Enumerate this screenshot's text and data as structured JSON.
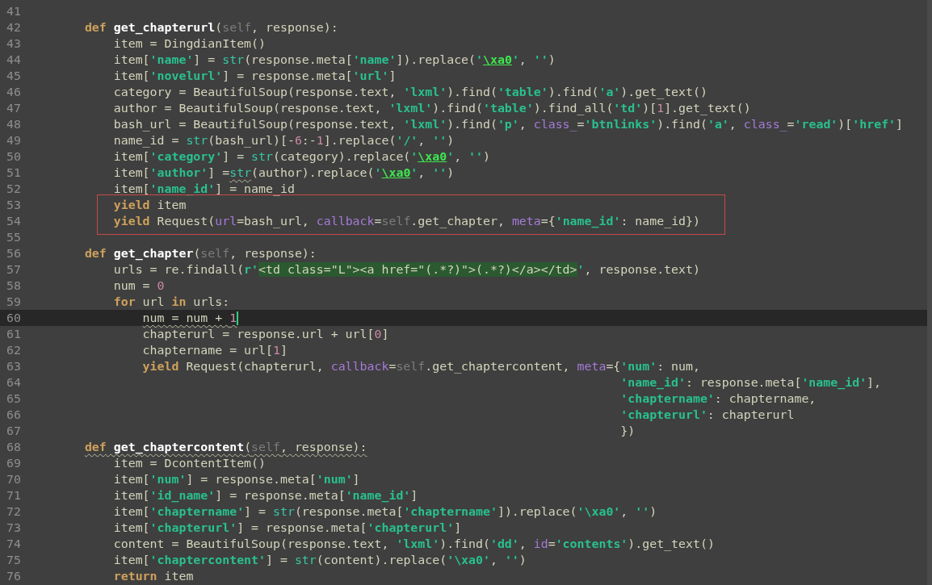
{
  "editor": {
    "lines": [
      {
        "number": "41",
        "current": false
      },
      {
        "number": "42",
        "current": false,
        "segments": [
          {
            "text": "    def",
            "kind": "keyword"
          },
          {
            "text": " get_chapterurl",
            "kind": "function"
          },
          {
            "text": "(",
            "kind": "plain"
          },
          {
            "text": "self",
            "kind": "self"
          },
          {
            "text": ", response):",
            "kind": "plain"
          }
        ]
      },
      {
        "number": "43",
        "current": false,
        "segments": [
          {
            "text": "        item = DingdianItem()",
            "kind": "plain"
          }
        ]
      },
      {
        "number": "44",
        "current": false,
        "segments": [
          {
            "text": "        item[",
            "kind": "plain"
          },
          {
            "text": "'name'",
            "kind": "string"
          },
          {
            "text": "] = ",
            "kind": "plain"
          },
          {
            "text": "str",
            "kind": "builtin"
          },
          {
            "text": "(response.meta[",
            "kind": "plain"
          },
          {
            "text": "'name'",
            "kind": "string"
          },
          {
            "text": "]).replace(",
            "kind": "plain"
          },
          {
            "text": "'",
            "kind": "string"
          },
          {
            "text": "\\xa0",
            "kind": "escape"
          },
          {
            "text": "'",
            "kind": "string"
          },
          {
            "text": ", ",
            "kind": "plain"
          },
          {
            "text": "''",
            "kind": "string"
          },
          {
            "text": ")",
            "kind": "plain"
          }
        ]
      },
      {
        "number": "45",
        "current": false,
        "segments": [
          {
            "text": "        item[",
            "kind": "plain"
          },
          {
            "text": "'novelurl'",
            "kind": "string"
          },
          {
            "text": "] = response.meta[",
            "kind": "plain"
          },
          {
            "text": "'url'",
            "kind": "string"
          },
          {
            "text": "]",
            "kind": "plain"
          }
        ]
      },
      {
        "number": "46",
        "current": false,
        "segments": [
          {
            "text": "        category = BeautifulSoup(response.text, ",
            "kind": "plain"
          },
          {
            "text": "'lxml'",
            "kind": "string"
          },
          {
            "text": ").find(",
            "kind": "plain"
          },
          {
            "text": "'table'",
            "kind": "string"
          },
          {
            "text": ").find(",
            "kind": "plain"
          },
          {
            "text": "'a'",
            "kind": "string"
          },
          {
            "text": ").get_text()",
            "kind": "plain"
          }
        ]
      },
      {
        "number": "47",
        "current": false,
        "segments": [
          {
            "text": "        author = BeautifulSoup(response.text, ",
            "kind": "plain"
          },
          {
            "text": "'lxml'",
            "kind": "string"
          },
          {
            "text": ").find(",
            "kind": "plain"
          },
          {
            "text": "'table'",
            "kind": "string"
          },
          {
            "text": ").find_all(",
            "kind": "plain"
          },
          {
            "text": "'td'",
            "kind": "string"
          },
          {
            "text": ")[",
            "kind": "plain"
          },
          {
            "text": "1",
            "kind": "number"
          },
          {
            "text": "].get_text()",
            "kind": "plain"
          }
        ]
      },
      {
        "number": "48",
        "current": false,
        "segments": [
          {
            "text": "        bash_url = BeautifulSoup(response.text, ",
            "kind": "plain"
          },
          {
            "text": "'lxml'",
            "kind": "string"
          },
          {
            "text": ").find(",
            "kind": "plain"
          },
          {
            "text": "'p'",
            "kind": "string"
          },
          {
            "text": ", ",
            "kind": "plain"
          },
          {
            "text": "class_",
            "kind": "param"
          },
          {
            "text": "=",
            "kind": "plain"
          },
          {
            "text": "'btnlinks'",
            "kind": "string"
          },
          {
            "text": ").find(",
            "kind": "plain"
          },
          {
            "text": "'a'",
            "kind": "string"
          },
          {
            "text": ", ",
            "kind": "plain"
          },
          {
            "text": "class_",
            "kind": "param"
          },
          {
            "text": "=",
            "kind": "plain"
          },
          {
            "text": "'read'",
            "kind": "string"
          },
          {
            "text": ")[",
            "kind": "plain"
          },
          {
            "text": "'href'",
            "kind": "string"
          },
          {
            "text": "]",
            "kind": "plain"
          }
        ]
      },
      {
        "number": "49",
        "current": false,
        "segments": [
          {
            "text": "        name_id = ",
            "kind": "plain"
          },
          {
            "text": "str",
            "kind": "builtin"
          },
          {
            "text": "(bash_url)[-",
            "kind": "plain"
          },
          {
            "text": "6",
            "kind": "number"
          },
          {
            "text": ":-",
            "kind": "plain"
          },
          {
            "text": "1",
            "kind": "number"
          },
          {
            "text": "].replace(",
            "kind": "plain"
          },
          {
            "text": "'/'",
            "kind": "string"
          },
          {
            "text": ", ",
            "kind": "plain"
          },
          {
            "text": "''",
            "kind": "string"
          },
          {
            "text": ")",
            "kind": "plain"
          }
        ]
      },
      {
        "number": "50",
        "current": false,
        "segments": [
          {
            "text": "        item[",
            "kind": "plain"
          },
          {
            "text": "'category'",
            "kind": "string"
          },
          {
            "text": "] = ",
            "kind": "plain"
          },
          {
            "text": "str",
            "kind": "builtin"
          },
          {
            "text": "(category).replace(",
            "kind": "plain"
          },
          {
            "text": "'",
            "kind": "string"
          },
          {
            "text": "\\xa0",
            "kind": "escape"
          },
          {
            "text": "'",
            "kind": "string"
          },
          {
            "text": ", ",
            "kind": "plain"
          },
          {
            "text": "''",
            "kind": "string"
          },
          {
            "text": ")",
            "kind": "plain"
          }
        ]
      },
      {
        "number": "51",
        "current": false,
        "segments": [
          {
            "text": "        item[",
            "kind": "plain"
          },
          {
            "text": "'author'",
            "kind": "string"
          },
          {
            "text": "] =",
            "kind": "plain"
          },
          {
            "text": "str",
            "kind": "builtin",
            "squiggle": true
          },
          {
            "text": "(author).replace(",
            "kind": "plain"
          },
          {
            "text": "'",
            "kind": "string"
          },
          {
            "text": "\\xa0",
            "kind": "escape"
          },
          {
            "text": "'",
            "kind": "string"
          },
          {
            "text": ", ",
            "kind": "plain"
          },
          {
            "text": "''",
            "kind": "string"
          },
          {
            "text": ")",
            "kind": "plain"
          }
        ]
      },
      {
        "number": "52",
        "current": false,
        "segments": [
          {
            "text": "        item[",
            "kind": "plain"
          },
          {
            "text": "'name_id'",
            "kind": "string"
          },
          {
            "text": "] = name_id",
            "kind": "plain"
          }
        ]
      },
      {
        "number": "53",
        "current": false,
        "boxed": true,
        "segments": [
          {
            "text": "        yield",
            "kind": "keyword"
          },
          {
            "text": " item",
            "kind": "plain"
          }
        ]
      },
      {
        "number": "54",
        "current": false,
        "boxed": true,
        "segments": [
          {
            "text": "        yield",
            "kind": "keyword"
          },
          {
            "text": " Request(",
            "kind": "plain"
          },
          {
            "text": "url",
            "kind": "param"
          },
          {
            "text": "=bash_url, ",
            "kind": "plain"
          },
          {
            "text": "callback",
            "kind": "param"
          },
          {
            "text": "=",
            "kind": "plain"
          },
          {
            "text": "self",
            "kind": "self"
          },
          {
            "text": ".get_chapter, ",
            "kind": "plain"
          },
          {
            "text": "meta",
            "kind": "param"
          },
          {
            "text": "={",
            "kind": "plain"
          },
          {
            "text": "'name_id'",
            "kind": "string"
          },
          {
            "text": ": name_id})",
            "kind": "plain"
          }
        ]
      },
      {
        "number": "55",
        "current": false
      },
      {
        "number": "56",
        "current": false,
        "segments": [
          {
            "text": "    def",
            "kind": "keyword"
          },
          {
            "text": " get_chapter",
            "kind": "function"
          },
          {
            "text": "(",
            "kind": "plain"
          },
          {
            "text": "self",
            "kind": "self"
          },
          {
            "text": ", response):",
            "kind": "plain"
          }
        ]
      },
      {
        "number": "57",
        "current": false,
        "segments": [
          {
            "text": "        urls = re.findall(",
            "kind": "plain"
          },
          {
            "text": "r'",
            "kind": "string"
          },
          {
            "text": "<td class=\"L\"><a href=\"(.*?)\">(.*?)</a></td>",
            "kind": "regex"
          },
          {
            "text": "'",
            "kind": "string"
          },
          {
            "text": ", response.text)",
            "kind": "plain"
          }
        ]
      },
      {
        "number": "58",
        "current": false,
        "segments": [
          {
            "text": "        num = ",
            "kind": "plain"
          },
          {
            "text": "0",
            "kind": "number"
          }
        ]
      },
      {
        "number": "59",
        "current": false,
        "segments": [
          {
            "text": "        for",
            "kind": "keyword"
          },
          {
            "text": " url ",
            "kind": "plain"
          },
          {
            "text": "in",
            "kind": "keyword"
          },
          {
            "text": " urls:",
            "kind": "plain"
          }
        ]
      },
      {
        "number": "60",
        "current": true,
        "segments": [
          {
            "text": "            num = num + ",
            "kind": "plain",
            "squiggle": true
          },
          {
            "text": "1",
            "kind": "number",
            "squiggle": true
          }
        ]
      },
      {
        "number": "61",
        "current": false,
        "segments": [
          {
            "text": "            chapterurl = response.url + url[",
            "kind": "plain"
          },
          {
            "text": "0",
            "kind": "number"
          },
          {
            "text": "]",
            "kind": "plain"
          }
        ]
      },
      {
        "number": "62",
        "current": false,
        "segments": [
          {
            "text": "            chaptername = url[",
            "kind": "plain"
          },
          {
            "text": "1",
            "kind": "number"
          },
          {
            "text": "]",
            "kind": "plain"
          }
        ]
      },
      {
        "number": "63",
        "current": false,
        "segments": [
          {
            "text": "            yield",
            "kind": "keyword"
          },
          {
            "text": " Request(chapterurl, ",
            "kind": "plain"
          },
          {
            "text": "callback",
            "kind": "param"
          },
          {
            "text": "=",
            "kind": "plain"
          },
          {
            "text": "self",
            "kind": "self"
          },
          {
            "text": ".get_chaptercontent, ",
            "kind": "plain"
          },
          {
            "text": "meta",
            "kind": "param"
          },
          {
            "text": "={",
            "kind": "plain"
          },
          {
            "text": "'num'",
            "kind": "string"
          },
          {
            "text": ": num,",
            "kind": "plain"
          }
        ]
      },
      {
        "number": "64",
        "current": false,
        "segments": [
          {
            "text": "                                                                              'name_id'",
            "kind": "string"
          },
          {
            "text": ": response.meta[",
            "kind": "plain"
          },
          {
            "text": "'name_id'",
            "kind": "string"
          },
          {
            "text": "],",
            "kind": "plain"
          }
        ]
      },
      {
        "number": "65",
        "current": false,
        "segments": [
          {
            "text": "                                                                              'chaptername'",
            "kind": "string"
          },
          {
            "text": ": chaptername,",
            "kind": "plain"
          }
        ]
      },
      {
        "number": "66",
        "current": false,
        "segments": [
          {
            "text": "                                                                              'chapterurl'",
            "kind": "string"
          },
          {
            "text": ": chapterurl",
            "kind": "plain"
          }
        ]
      },
      {
        "number": "67",
        "current": false,
        "segments": [
          {
            "text": "                                                                              })",
            "kind": "plain"
          }
        ]
      },
      {
        "number": "68",
        "current": false,
        "segments": [
          {
            "text": "    def",
            "kind": "keyword",
            "squiggle": true
          },
          {
            "text": " get_chaptercontent",
            "kind": "function",
            "squiggle": true
          },
          {
            "text": "(",
            "kind": "plain",
            "squiggle": true
          },
          {
            "text": "self",
            "kind": "self",
            "squiggle": true
          },
          {
            "text": ", response):",
            "kind": "plain",
            "squiggle": true
          }
        ]
      },
      {
        "number": "69",
        "current": false,
        "segments": [
          {
            "text": "        item = DcontentItem()",
            "kind": "plain"
          }
        ]
      },
      {
        "number": "70",
        "current": false,
        "segments": [
          {
            "text": "        item[",
            "kind": "plain"
          },
          {
            "text": "'num'",
            "kind": "string"
          },
          {
            "text": "] = response.meta[",
            "kind": "plain"
          },
          {
            "text": "'num'",
            "kind": "string"
          },
          {
            "text": "]",
            "kind": "plain"
          }
        ]
      },
      {
        "number": "71",
        "current": false,
        "segments": [
          {
            "text": "        item[",
            "kind": "plain"
          },
          {
            "text": "'id_name'",
            "kind": "string"
          },
          {
            "text": "] = response.meta[",
            "kind": "plain"
          },
          {
            "text": "'name_id'",
            "kind": "string"
          },
          {
            "text": "]",
            "kind": "plain"
          }
        ]
      },
      {
        "number": "72",
        "current": false,
        "segments": [
          {
            "text": "        item[",
            "kind": "plain"
          },
          {
            "text": "'chaptername'",
            "kind": "string"
          },
          {
            "text": "] = ",
            "kind": "plain"
          },
          {
            "text": "str",
            "kind": "builtin"
          },
          {
            "text": "(response.meta[",
            "kind": "plain"
          },
          {
            "text": "'chaptername'",
            "kind": "string"
          },
          {
            "text": "]).replace(",
            "kind": "plain"
          },
          {
            "text": "'\\xa0'",
            "kind": "string"
          },
          {
            "text": ", ",
            "kind": "plain"
          },
          {
            "text": "''",
            "kind": "string"
          },
          {
            "text": ")",
            "kind": "plain"
          }
        ]
      },
      {
        "number": "73",
        "current": false,
        "segments": [
          {
            "text": "        item[",
            "kind": "plain"
          },
          {
            "text": "'chapterurl'",
            "kind": "string"
          },
          {
            "text": "] = response.meta[",
            "kind": "plain"
          },
          {
            "text": "'chapterurl'",
            "kind": "string"
          },
          {
            "text": "]",
            "kind": "plain"
          }
        ]
      },
      {
        "number": "74",
        "current": false,
        "segments": [
          {
            "text": "        content = BeautifulSoup(response.text, ",
            "kind": "plain"
          },
          {
            "text": "'lxml'",
            "kind": "string"
          },
          {
            "text": ").find(",
            "kind": "plain"
          },
          {
            "text": "'dd'",
            "kind": "string"
          },
          {
            "text": ", ",
            "kind": "plain"
          },
          {
            "text": "id",
            "kind": "param"
          },
          {
            "text": "=",
            "kind": "plain"
          },
          {
            "text": "'contents'",
            "kind": "string"
          },
          {
            "text": ").get_text()",
            "kind": "plain"
          }
        ]
      },
      {
        "number": "75",
        "current": false,
        "segments": [
          {
            "text": "        item[",
            "kind": "plain"
          },
          {
            "text": "'chaptercontent'",
            "kind": "string"
          },
          {
            "text": "] = ",
            "kind": "plain"
          },
          {
            "text": "str",
            "kind": "builtin"
          },
          {
            "text": "(content).replace(",
            "kind": "plain"
          },
          {
            "text": "'\\xa0'",
            "kind": "string"
          },
          {
            "text": ", ",
            "kind": "plain"
          },
          {
            "text": "''",
            "kind": "string"
          },
          {
            "text": ")",
            "kind": "plain"
          }
        ]
      },
      {
        "number": "76",
        "current": false,
        "segments": [
          {
            "text": "        return",
            "kind": "keyword"
          },
          {
            "text": " item",
            "kind": "plain"
          }
        ]
      }
    ]
  }
}
